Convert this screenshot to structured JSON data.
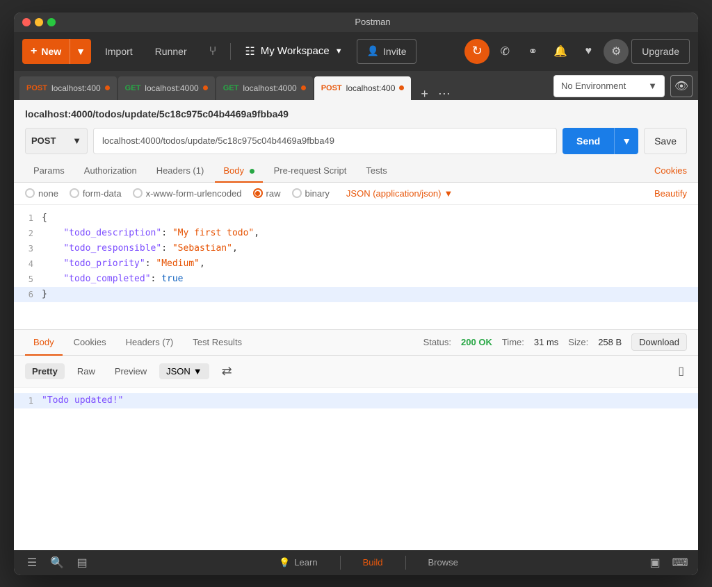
{
  "window": {
    "title": "Postman"
  },
  "toolbar": {
    "new_label": "New",
    "import_label": "Import",
    "runner_label": "Runner",
    "workspace_label": "My Workspace",
    "invite_label": "Invite",
    "upgrade_label": "Upgrade"
  },
  "tabs": [
    {
      "method": "POST",
      "url": "localhost:400",
      "dot_color": "orange",
      "active": false
    },
    {
      "method": "GET",
      "url": "localhost:4000",
      "dot_color": "green",
      "active": false
    },
    {
      "method": "GET",
      "url": "localhost:4000",
      "dot_color": "green",
      "active": false
    },
    {
      "method": "POST",
      "url": "localhost:400",
      "dot_color": "orange",
      "active": true
    }
  ],
  "environment": {
    "label": "No Environment",
    "placeholder": "No Environment"
  },
  "request": {
    "url_heading": "localhost:4000/todos/update/5c18c975c04b4469a9fbba49",
    "method": "POST",
    "url": "localhost:4000/todos/update/5c18c975c04b4469a9fbba49",
    "send_label": "Send",
    "save_label": "Save"
  },
  "request_tabs": {
    "params": "Params",
    "authorization": "Authorization",
    "headers": "Headers (1)",
    "body": "Body",
    "pre_request": "Pre-request Script",
    "tests": "Tests",
    "cookies": "Cookies"
  },
  "body_options": {
    "none": "none",
    "form_data": "form-data",
    "urlencoded": "x-www-form-urlencoded",
    "raw": "raw",
    "binary": "binary",
    "json_type": "JSON (application/json)",
    "beautify": "Beautify"
  },
  "code": {
    "lines": [
      {
        "num": "1",
        "content": "{",
        "type": "bracket"
      },
      {
        "num": "2",
        "content": "  \"todo_description\": \"My first todo\",",
        "type": "kv"
      },
      {
        "num": "3",
        "content": "  \"todo_responsible\": \"Sebastian\",",
        "type": "kv"
      },
      {
        "num": "4",
        "content": "  \"todo_priority\": \"Medium\",",
        "type": "kv"
      },
      {
        "num": "5",
        "content": "  \"todo_completed\": true",
        "type": "kv_bool"
      },
      {
        "num": "6",
        "content": "}",
        "type": "bracket_close",
        "highlighted": true
      }
    ]
  },
  "response": {
    "tabs": {
      "body": "Body",
      "cookies": "Cookies",
      "headers": "Headers (7)",
      "test_results": "Test Results"
    },
    "status": "200 OK",
    "time": "31 ms",
    "size": "258 B",
    "download_label": "Download",
    "format_pretty": "Pretty",
    "format_raw": "Raw",
    "format_preview": "Preview",
    "format_json": "JSON",
    "response_line": "\"Todo updated!\""
  },
  "bottom_nav": {
    "learn": "Learn",
    "build": "Build",
    "browse": "Browse"
  }
}
